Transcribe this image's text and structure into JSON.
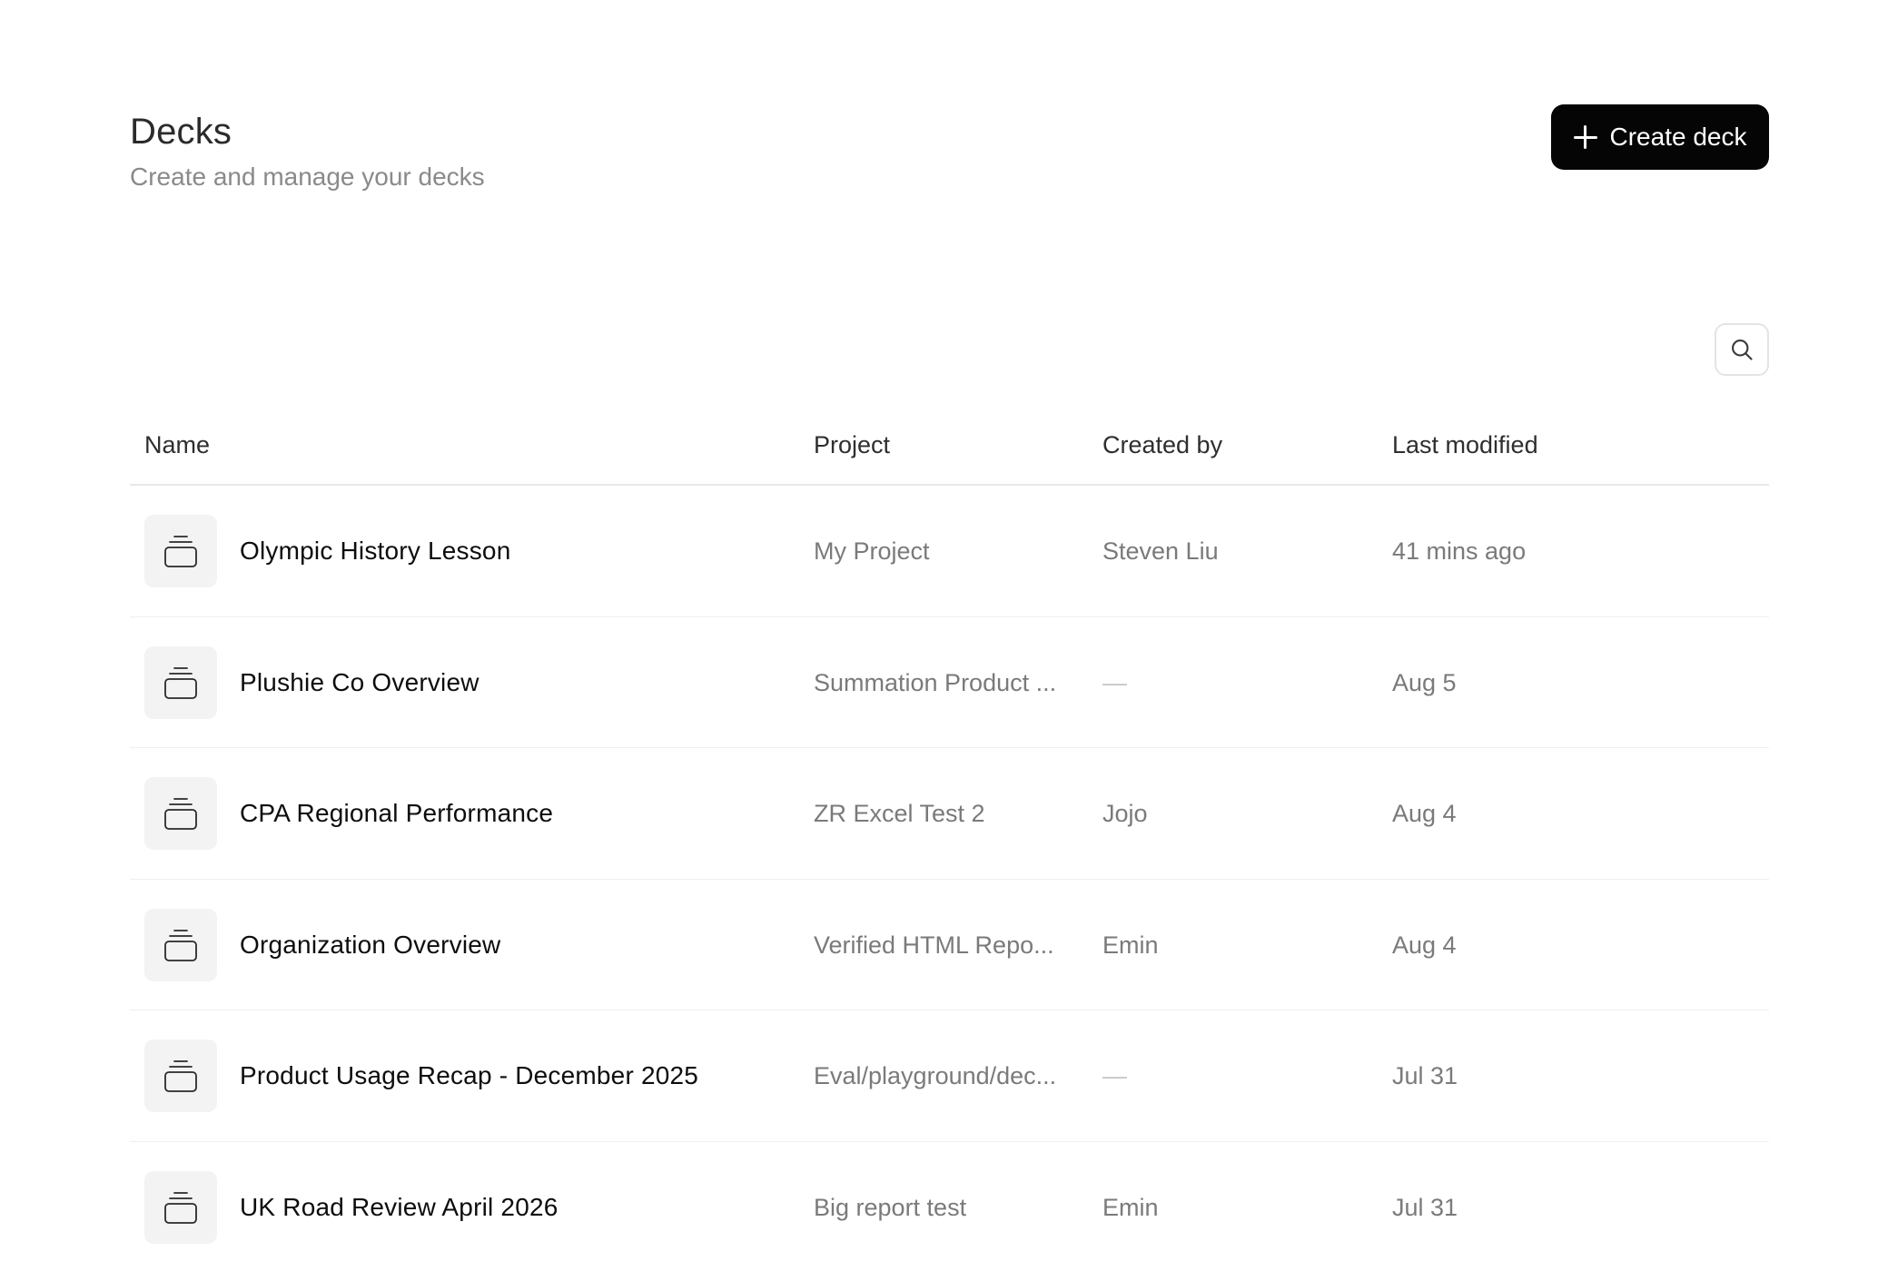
{
  "header": {
    "title": "Decks",
    "subtitle": "Create and manage your decks",
    "create_button_label": "Create deck"
  },
  "icons": {
    "create": "plus-icon",
    "search": "search-icon",
    "deck": "deck-icon"
  },
  "colors": {
    "primary_button": "#050505",
    "muted_text": "#7a7a7a",
    "icon_tile": "#f3f3f3"
  },
  "table": {
    "columns": [
      "Name",
      "Project",
      "Created by",
      "Last modified"
    ],
    "rows": [
      {
        "name": "Olympic History Lesson",
        "project": "My Project",
        "created_by": "Steven Liu",
        "last_modified": "41 mins ago"
      },
      {
        "name": "Plushie Co Overview",
        "project": "Summation Product ...",
        "created_by": "—",
        "last_modified": "Aug 5"
      },
      {
        "name": "CPA Regional Performance",
        "project": "ZR Excel Test 2",
        "created_by": "Jojo",
        "last_modified": "Aug 4"
      },
      {
        "name": "Organization Overview",
        "project": "Verified HTML Repo...",
        "created_by": "Emin",
        "last_modified": "Aug 4"
      },
      {
        "name": "Product Usage Recap - December 2025",
        "project": "Eval/playground/dec...",
        "created_by": "—",
        "last_modified": "Jul 31"
      },
      {
        "name": "UK Road Review April 2026",
        "project": "Big report test",
        "created_by": "Emin",
        "last_modified": "Jul 31"
      }
    ]
  }
}
